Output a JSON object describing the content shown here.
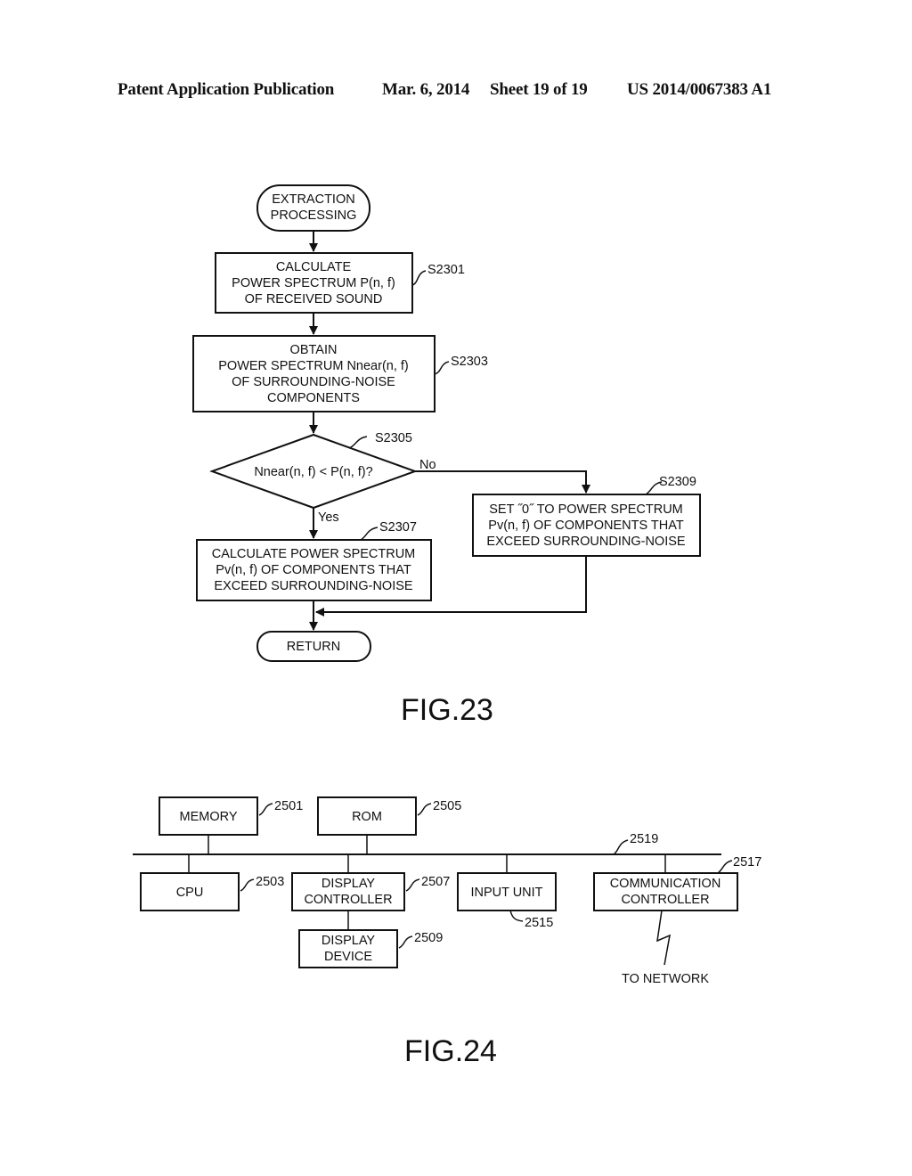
{
  "header": {
    "publication": "Patent Application Publication",
    "date": "Mar. 6, 2014",
    "sheet": "Sheet 19 of 19",
    "number": "US 2014/0067383 A1"
  },
  "fig23": {
    "caption": "FIG.23",
    "start": [
      "EXTRACTION",
      "PROCESSING"
    ],
    "s2301": {
      "ref": "S2301",
      "lines": [
        "CALCULATE",
        "POWER SPECTRUM P(n, f)",
        "OF RECEIVED SOUND"
      ]
    },
    "s2303": {
      "ref": "S2303",
      "lines": [
        "OBTAIN",
        "POWER SPECTRUM Nnear(n, f)",
        "OF SURROUNDING-NOISE",
        "COMPONENTS"
      ]
    },
    "s2305": {
      "ref": "S2305",
      "question": "Nnear(n, f) < P(n, f)?",
      "yes": "Yes",
      "no": "No"
    },
    "s2307": {
      "ref": "S2307",
      "lines": [
        "CALCULATE POWER SPECTRUM",
        "Pv(n, f) OF COMPONENTS THAT",
        "EXCEED SURROUNDING-NOISE"
      ]
    },
    "s2309": {
      "ref": "S2309",
      "lines": [
        "SET ˝0˝ TO POWER SPECTRUM",
        "Pv(n, f) OF COMPONENTS THAT",
        "EXCEED SURROUNDING-NOISE"
      ]
    },
    "end": "RETURN"
  },
  "fig24": {
    "caption": "FIG.24",
    "memory": {
      "label": "MEMORY",
      "ref": "2501"
    },
    "cpu": {
      "label": "CPU",
      "ref": "2503"
    },
    "rom": {
      "label": "ROM",
      "ref": "2505"
    },
    "display_controller": {
      "lines": [
        "DISPLAY",
        "CONTROLLER"
      ],
      "ref": "2507"
    },
    "display_device": {
      "lines": [
        "DISPLAY",
        "DEVICE"
      ],
      "ref": "2509"
    },
    "input_unit": {
      "label": "INPUT UNIT",
      "ref": "2515"
    },
    "comm_controller": {
      "lines": [
        "COMMUNICATION",
        "CONTROLLER"
      ],
      "ref": "2517"
    },
    "bus": {
      "ref": "2519"
    },
    "network": "TO NETWORK"
  }
}
